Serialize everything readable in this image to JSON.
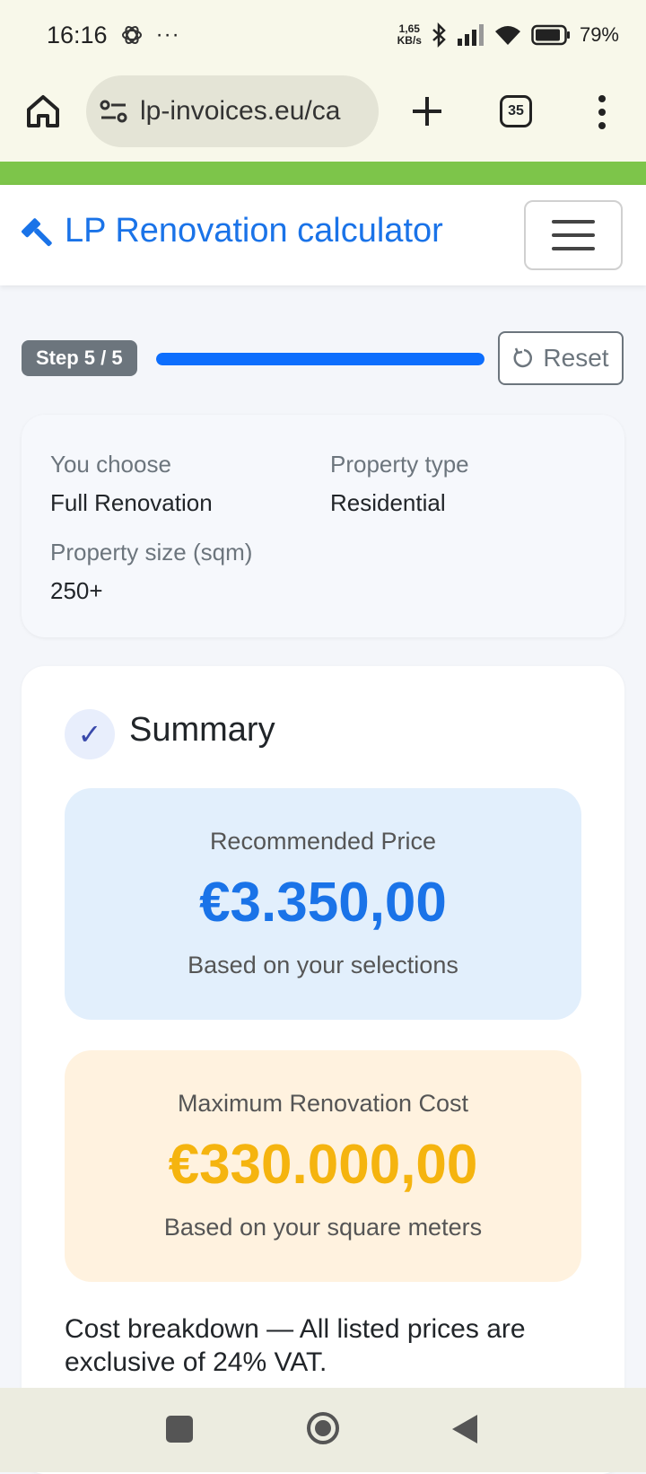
{
  "status_bar": {
    "time": "16:16",
    "net_speed_value": "1,65",
    "net_speed_unit": "KB/s",
    "battery": "79%",
    "icons": [
      "chatgpt-icon",
      "more-dots-icon",
      "bluetooth-icon",
      "signal-icon",
      "wifi-icon",
      "battery-icon"
    ]
  },
  "browser": {
    "url": "lp-invoices.eu/ca",
    "tab_count": "35",
    "icons": [
      "home-icon",
      "site-settings-icon",
      "plus-icon",
      "tabs-icon",
      "kebab-menu-icon"
    ]
  },
  "colors": {
    "accent_blue": "#1a73e8",
    "green_bar": "#7dc54a",
    "max_cost": "#f5b40f"
  },
  "navbar": {
    "brand": "LP Renovation calculator",
    "brand_icon": "hammer-icon",
    "menu_icon": "hamburger-icon"
  },
  "progress": {
    "step_label": "Step 5 / 5",
    "percent": 100,
    "reset_label": "Reset"
  },
  "selections": {
    "choice_label": "You choose",
    "choice_value": "Full Renovation",
    "type_label": "Property type",
    "type_value": "Residential",
    "size_label": "Property size (sqm)",
    "size_value": "250+"
  },
  "summary": {
    "title": "Summary",
    "recommended_label": "Recommended Price",
    "recommended_value": "€3.350,00",
    "recommended_note": "Based on your selections",
    "max_label": "Maximum Renovation Cost",
    "max_value": "€330.000,00",
    "max_note": "Based on your square meters",
    "breakdown_text": "Cost breakdown — All listed prices are exclusive of 24% VAT."
  },
  "system_nav": {
    "icons": [
      "recents-icon",
      "home-circle-icon",
      "back-icon"
    ]
  }
}
